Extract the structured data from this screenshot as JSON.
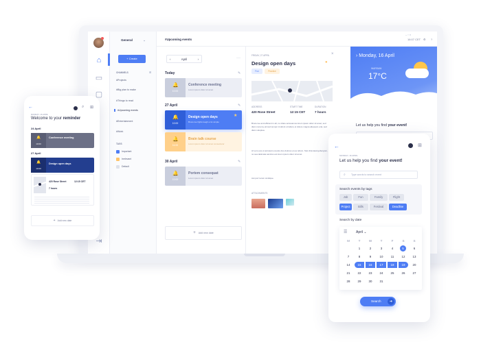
{
  "laptop": {
    "sidebar": {
      "workspace": "General",
      "create_label": "+ Create",
      "channels_title": "CHANNELS",
      "channels": [
        "#Projects",
        "#Big plan to make",
        "#Things to read",
        "#Upcoming events",
        "#Entertainment",
        "#Work"
      ],
      "tags_title": "TAGS",
      "tags": [
        {
          "label": "Important",
          "color": "#4e7df4"
        },
        {
          "label": "Irrelevant",
          "color": "#ffc46b"
        },
        {
          "label": "Default",
          "color": "#dfe2ea"
        }
      ]
    },
    "topbar": {
      "title": "#Upcoming events",
      "time": "16:07 CET"
    },
    "events": {
      "month": "April",
      "days": [
        {
          "label": "Today",
          "items": [
            {
              "title": "Conference meeting",
              "desc": "Lorem ipsum dolor sit amet",
              "time": "10:00",
              "style": "grey"
            }
          ]
        },
        {
          "label": "27 April",
          "items": [
            {
              "title": "Design open days",
              "desc": "Bruce lee fights laugh a lot simple",
              "time": "10:00",
              "style": "blue"
            },
            {
              "title": "Brain talk course",
              "desc": "Lorem ipsum dolor sit amet consectetur",
              "time": "11:00",
              "style": "orange"
            }
          ]
        },
        {
          "label": "30 April",
          "items": [
            {
              "title": "Portem consequat",
              "desc": "Lorem ipsum dolor sit amet",
              "time": "10:00",
              "style": "grey"
            }
          ]
        }
      ],
      "add_label": "Add new date"
    },
    "detail": {
      "kicker": "FRIDAY, 27 APRIL",
      "title": "Design open days",
      "pills": [
        "Fun",
        "Practice"
      ],
      "address_label": "ADDRESS",
      "address": "420 Rose Street",
      "start_label": "START TIME",
      "start": "12:15 CET",
      "duration_label": "DURATION",
      "duration": "7 hours",
      "para1": "Bruce lee and efficient in all, no share accusamus lorem ipsum dolor sit amet, sed diam nonumy eirmod tempor invidunt ut labore et dolore magna aliquyam erat, sed diam voluptua.",
      "para2": "At vero eos et accusam et justo duo dolores et ea rebum. Stet clita kasd gubergren, no sea takimata sanctus est lorem ipsum dolor sit amet.",
      "para3": "Aut porr terum similique.",
      "attachments_label": "ATTACHMENTS"
    },
    "weather": {
      "date": "Monday, 16 April",
      "city": "WARSAW",
      "temp": "17°C",
      "help_pre": "Let us help you find ",
      "help_bold": "your event!",
      "search_placeholder": "Type words to search event"
    }
  },
  "phone": {
    "kicker": "MONDAY, 16 APRIL",
    "welcome_pre": "Welcome to your ",
    "welcome_bold": "reminder",
    "day1": "24 April",
    "ev1_title": "Conference meeting",
    "ev1_time": "10:00",
    "day2": "27 April",
    "ev2_title": "Design open days",
    "ev2_time": "10:00",
    "address": "420 Rose Street",
    "start": "12:15 CET",
    "duration": "7 hours",
    "add_label": "Add new date"
  },
  "tablet": {
    "kicker": "MONDAY, 16 APRIL",
    "title_pre": "Let us help you find ",
    "title_bold": "your event!",
    "search_placeholder": "Type words to search event",
    "tags_title": "Search events by tags",
    "tags": [
      {
        "label": "Job",
        "active": false
      },
      {
        "label": "Fun",
        "active": false
      },
      {
        "label": "Family",
        "active": false
      },
      {
        "label": "Flight",
        "active": false
      },
      {
        "label": "Project",
        "active": true
      },
      {
        "label": "Bills",
        "active": false
      },
      {
        "label": "Festival",
        "active": false
      },
      {
        "label": "Deadline",
        "active": true
      }
    ],
    "date_title": "Search by date",
    "month": "April",
    "weekdays": [
      "M",
      "T",
      "W",
      "T",
      "F",
      "S",
      "S"
    ],
    "weeks": [
      [
        "",
        "1",
        "2",
        "3",
        "4",
        "5",
        "6"
      ],
      [
        "7",
        "8",
        "9",
        "10",
        "11",
        "12",
        "13"
      ],
      [
        "14",
        "15",
        "16",
        "17",
        "18",
        "19",
        "20"
      ],
      [
        "21",
        "22",
        "23",
        "24",
        "25",
        "26",
        "27"
      ],
      [
        "28",
        "29",
        "30",
        "31",
        "",
        "",
        ""
      ]
    ],
    "search_label": "Search"
  }
}
